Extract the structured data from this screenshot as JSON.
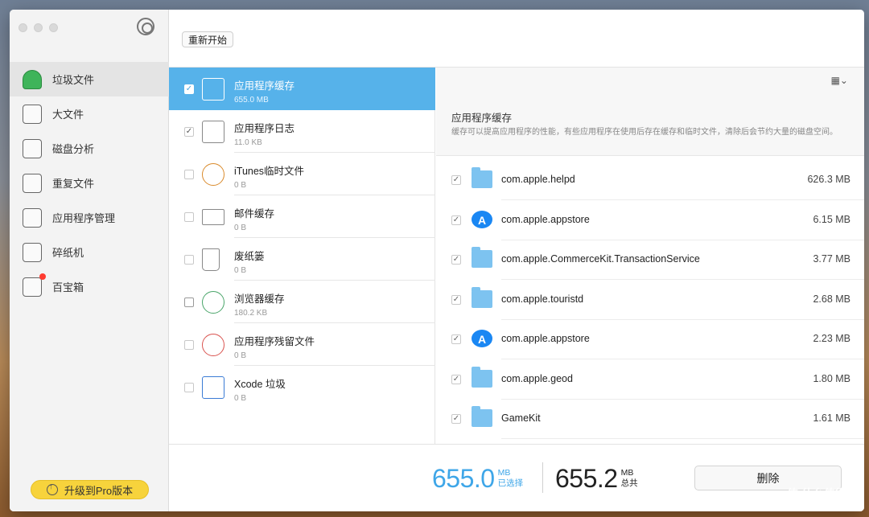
{
  "sidebar": {
    "items": [
      {
        "label": "垃圾文件",
        "icon": "vacuum-icon",
        "active": true
      },
      {
        "label": "大文件",
        "icon": "box-icon"
      },
      {
        "label": "磁盘分析",
        "icon": "disk-icon"
      },
      {
        "label": "重复文件",
        "icon": "duplicate-icon"
      },
      {
        "label": "应用程序管理",
        "icon": "apps-icon"
      },
      {
        "label": "碎纸机",
        "icon": "shredder-icon"
      },
      {
        "label": "百宝箱",
        "icon": "toolbox-icon",
        "badge": true
      }
    ],
    "upgrade_label": "升级到Pro版本"
  },
  "toolbar": {
    "restart_label": "重新开始"
  },
  "categories": [
    {
      "name": "应用程序缓存",
      "size": "655.0 MB",
      "checked": true,
      "selected": true,
      "icon": "app-cache-icon"
    },
    {
      "name": "应用程序日志",
      "size": "11.0 KB",
      "checked": true,
      "icon": "log-icon"
    },
    {
      "name": "iTunes临时文件",
      "size": "0 B",
      "checked": false,
      "icon": "itunes-icon"
    },
    {
      "name": "邮件缓存",
      "size": "0 B",
      "checked": false,
      "icon": "mail-icon"
    },
    {
      "name": "废纸篓",
      "size": "0 B",
      "checked": false,
      "icon": "trash-icon"
    },
    {
      "name": "浏览器缓存",
      "size": "180.2 KB",
      "checked": false,
      "icon": "safari-icon"
    },
    {
      "name": "应用程序残留文件",
      "size": "0 B",
      "checked": false,
      "icon": "leftover-icon"
    },
    {
      "name": "Xcode 垃圾",
      "size": "0 B",
      "checked": false,
      "icon": "xcode-icon"
    }
  ],
  "detail": {
    "view_icon": "grid-view-icon",
    "title": "应用程序缓存",
    "description": "缓存可以提高应用程序的性能，有些应用程序在使用后存在缓存和临时文件，清除后会节约大量的磁盘空间。",
    "files": [
      {
        "name": "com.apple.helpd",
        "size": "626.3 MB",
        "icon": "folder"
      },
      {
        "name": "com.apple.appstore",
        "size": "6.15 MB",
        "icon": "appstore"
      },
      {
        "name": "com.apple.CommerceKit.TransactionService",
        "size": "3.77 MB",
        "icon": "folder"
      },
      {
        "name": "com.apple.touristd",
        "size": "2.68 MB",
        "icon": "folder"
      },
      {
        "name": "com.apple.appstore",
        "size": "2.23 MB",
        "icon": "appstore"
      },
      {
        "name": "com.apple.geod",
        "size": "1.80 MB",
        "icon": "folder"
      },
      {
        "name": "GameKit",
        "size": "1.61 MB",
        "icon": "folder"
      }
    ]
  },
  "summary": {
    "selected_value": "655.0",
    "selected_unit": "MB",
    "selected_label": "已选择",
    "total_value": "655.2",
    "total_unit": "MB",
    "total_label": "总共",
    "delete_label": "删除"
  },
  "watermark": "值 什么值得买",
  "colors": {
    "accent": "#3ea6e8",
    "selection": "#56b2ea",
    "upgrade": "#f7d33c",
    "badge": "#ff3b30"
  }
}
